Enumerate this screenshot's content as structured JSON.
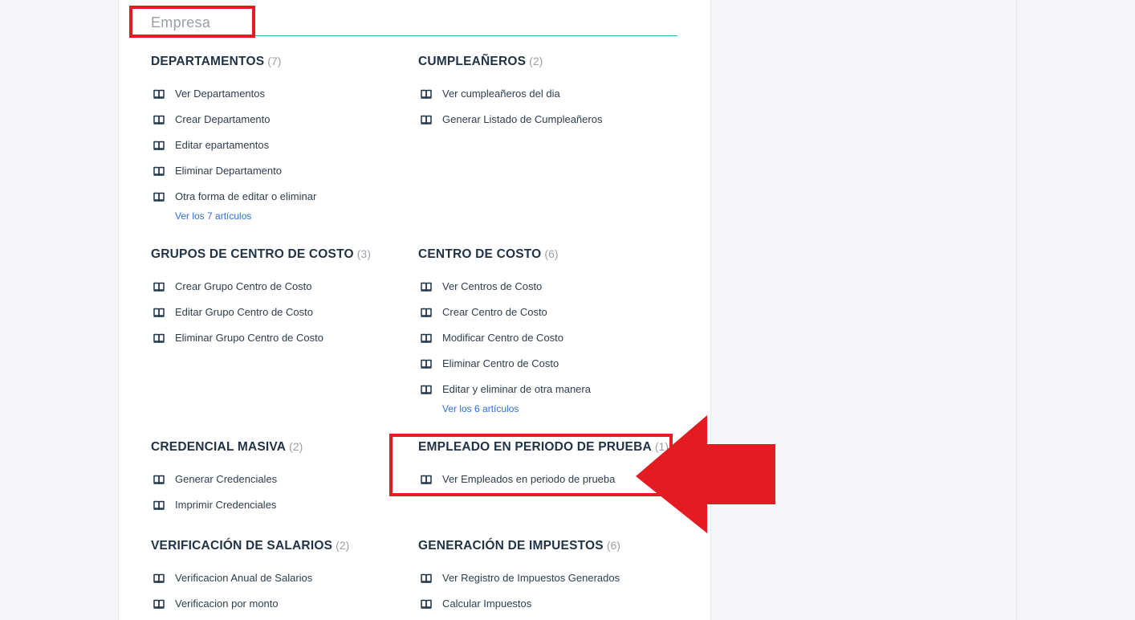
{
  "section": {
    "title": "Empresa"
  },
  "categories": [
    {
      "title": "DEPARTAMENTOS",
      "count": "(7)",
      "items": [
        "Ver Departamentos",
        "Crear Departamento",
        "Editar epartamentos",
        "Eliminar Departamento",
        "Otra forma de editar o eliminar"
      ],
      "see_all": "Ver los 7 artículos"
    },
    {
      "title": "CUMPLEAÑEROS",
      "count": "(2)",
      "items": [
        "Ver cumpleañeros del dia",
        "Generar Listado de Cumpleañeros"
      ]
    },
    {
      "title": "GRUPOS DE CENTRO DE COSTO",
      "count": "(3)",
      "items": [
        "Crear Grupo Centro de Costo",
        "Editar Grupo Centro de Costo",
        "Eliminar Grupo Centro de Costo"
      ]
    },
    {
      "title": "CENTRO DE COSTO",
      "count": "(6)",
      "items": [
        "Ver Centros de Costo",
        "Crear Centro de Costo",
        "Modificar Centro de Costo",
        "Eliminar Centro de Costo",
        "Editar y eliminar de otra manera"
      ],
      "see_all": "Ver los 6 artículos"
    },
    {
      "title": "CREDENCIAL MASIVA",
      "count": "(2)",
      "items": [
        "Generar Credenciales",
        "Imprimir Credenciales"
      ]
    },
    {
      "title": "EMPLEADO EN PERIODO DE PRUEBA",
      "count": "(1)",
      "items": [
        "Ver Empleados en periodo de prueba"
      ]
    },
    {
      "title": "VERIFICACIÓN DE SALARIOS",
      "count": "(2)",
      "items": [
        "Verificacion Anual de Salarios",
        "Verificacion por monto"
      ]
    },
    {
      "title": "GENERACIÓN DE IMPUESTOS",
      "count": "(6)",
      "items": [
        "Ver Registro de Impuestos Generados",
        "Calcular Impuestos"
      ]
    }
  ],
  "annotation": {
    "color": "#e31c23"
  }
}
